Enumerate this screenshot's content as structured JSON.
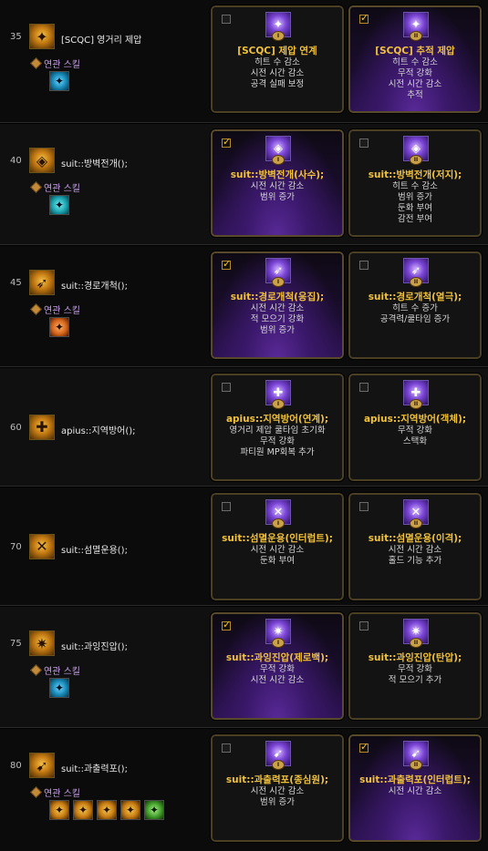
{
  "related_label": "연관 스킬",
  "rows": [
    {
      "level": "35",
      "name": "[SCQC] 영거리 제압",
      "has_related": true,
      "related": [
        {
          "icon": "skill-blue-icon",
          "tone": "blue"
        }
      ],
      "cards": [
        {
          "checked": false,
          "selected": false,
          "numeral": "I",
          "title": "[SCQC] 제압 연계",
          "desc": [
            "히트 수 감소",
            "시전 시간 감소",
            "공격 실패 보정"
          ]
        },
        {
          "checked": true,
          "selected": true,
          "numeral": "II",
          "title": "[SCQC] 추적 제압",
          "desc": [
            "히트 수 감소",
            "무적 강화",
            "시전 시간 감소",
            "추적"
          ]
        }
      ]
    },
    {
      "level": "40",
      "name": "suit::방벽전개();",
      "has_related": true,
      "related": [
        {
          "icon": "skill-teal-icon",
          "tone": "teal"
        }
      ],
      "cards": [
        {
          "checked": true,
          "selected": true,
          "numeral": "I",
          "title": "suit::방벽전개(사수);",
          "desc": [
            "시전 시간 감소",
            "범위 증가"
          ]
        },
        {
          "checked": false,
          "selected": false,
          "numeral": "II",
          "title": "suit::방벽전개(저지);",
          "desc": [
            "히트 수 감소",
            "범위 증가",
            "둔화 부여",
            "감전 부여"
          ]
        }
      ]
    },
    {
      "level": "45",
      "name": "suit::경로개척();",
      "has_related": true,
      "related": [
        {
          "icon": "skill-orange-icon",
          "tone": "orange"
        }
      ],
      "cards": [
        {
          "checked": true,
          "selected": true,
          "numeral": "I",
          "title": "suit::경로개척(응집);",
          "desc": [
            "시전 시간 감소",
            "적 모으기 강화",
            "범위 증가"
          ]
        },
        {
          "checked": false,
          "selected": false,
          "numeral": "II",
          "title": "suit::경로개척(열극);",
          "desc": [
            "히트 수 증가",
            "공격력/쿨타임 증가"
          ]
        }
      ]
    },
    {
      "level": "60",
      "name": "apius::지역방어();",
      "has_related": false,
      "related": [],
      "cards": [
        {
          "checked": false,
          "selected": false,
          "numeral": "I",
          "title": "apius::지역방어(연계);",
          "desc": [
            "영거리 제압 쿨타임 초기화",
            "무적 강화",
            "파티원 MP회복 추가"
          ]
        },
        {
          "checked": false,
          "selected": false,
          "numeral": "II",
          "title": "apius::지역방어(객체);",
          "desc": [
            "무적 강화",
            "스택화"
          ]
        }
      ]
    },
    {
      "level": "70",
      "name": "suit::섬멸운용();",
      "has_related": false,
      "related": [],
      "cards": [
        {
          "checked": false,
          "selected": false,
          "numeral": "I",
          "title": "suit::섬멸운용(인터럽트);",
          "desc": [
            "시전 시간 감소",
            "둔화 부여"
          ]
        },
        {
          "checked": false,
          "selected": false,
          "numeral": "II",
          "title": "suit::섬멸운용(이격);",
          "desc": [
            "시전 시간 감소",
            "홀드 기능 추가"
          ]
        }
      ]
    },
    {
      "level": "75",
      "name": "suit::과잉진압();",
      "has_related": true,
      "related": [
        {
          "icon": "skill-blue-icon",
          "tone": "blue"
        }
      ],
      "cards": [
        {
          "checked": true,
          "selected": true,
          "numeral": "I",
          "title": "suit::과잉진압(제로백);",
          "desc": [
            "무적 강화",
            "시전 시간 감소"
          ]
        },
        {
          "checked": false,
          "selected": false,
          "numeral": "II",
          "title": "suit::과잉진압(탄압);",
          "desc": [
            "무적 강화",
            "적 모으기 추가"
          ]
        }
      ]
    },
    {
      "level": "80",
      "name": "suit::과출력포();",
      "has_related": true,
      "related": [
        {
          "icon": "skill-gold-icon",
          "tone": "gold"
        },
        {
          "icon": "skill-gold-icon",
          "tone": "gold"
        },
        {
          "icon": "skill-gold-icon",
          "tone": "gold"
        },
        {
          "icon": "skill-gold-icon",
          "tone": "gold"
        },
        {
          "icon": "skill-green-icon",
          "tone": "green"
        }
      ],
      "cards": [
        {
          "checked": false,
          "selected": false,
          "numeral": "I",
          "title": "suit::과출력포(종심원);",
          "desc": [
            "시전 시간 감소",
            "범위 증가"
          ]
        },
        {
          "checked": true,
          "selected": true,
          "numeral": "II",
          "title": "suit::과출력포(인터럽트);",
          "desc": [
            "시전 시간 감소"
          ]
        }
      ]
    }
  ]
}
